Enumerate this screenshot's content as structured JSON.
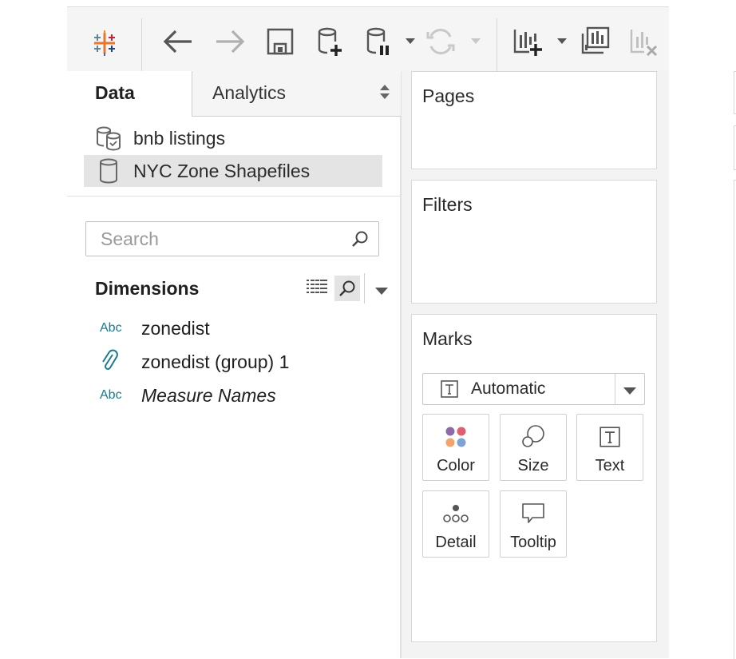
{
  "toolbar": {
    "icons": [
      "tableau-logo-icon",
      "back-arrow-icon",
      "forward-arrow-icon",
      "save-icon",
      "new-data-source-icon",
      "pause-updates-icon",
      "dropdown-caret-icon",
      "refresh-icon",
      "dropdown-caret-icon",
      "new-worksheet-icon",
      "dropdown-caret-icon",
      "duplicate-sheet-icon",
      "clear-sheet-icon"
    ]
  },
  "left_panel": {
    "tabs": {
      "data": "Data",
      "analytics": "Analytics"
    },
    "data_sources": [
      {
        "label": "bnb listings",
        "icon": "blended-datasource-icon"
      },
      {
        "label": "NYC Zone Shapefiles",
        "icon": "datasource-icon",
        "selected": true
      }
    ],
    "search": {
      "placeholder": "Search",
      "value": ""
    },
    "dimensions": {
      "title": "Dimensions",
      "fields": [
        {
          "type": "Abc",
          "name": "zonedist",
          "italic": false
        },
        {
          "type": "paperclip-icon",
          "name": "zonedist (group) 1",
          "italic": false
        },
        {
          "type": "Abc",
          "name": "Measure Names",
          "italic": true
        }
      ]
    }
  },
  "cards": {
    "pages": {
      "title": "Pages"
    },
    "filters": {
      "title": "Filters"
    },
    "marks": {
      "title": "Marks",
      "mark_type": "Automatic",
      "buttons": [
        {
          "label": "Color",
          "icon": "color-dots-icon"
        },
        {
          "label": "Size",
          "icon": "size-circles-icon"
        },
        {
          "label": "Text",
          "icon": "text-t-icon"
        },
        {
          "label": "Detail",
          "icon": "detail-dots-icon"
        },
        {
          "label": "Tooltip",
          "icon": "tooltip-bubble-icon"
        }
      ],
      "color_dots": [
        "#8e6aa8",
        "#e05f6f",
        "#f3a36b",
        "#7fa2d4"
      ]
    }
  }
}
